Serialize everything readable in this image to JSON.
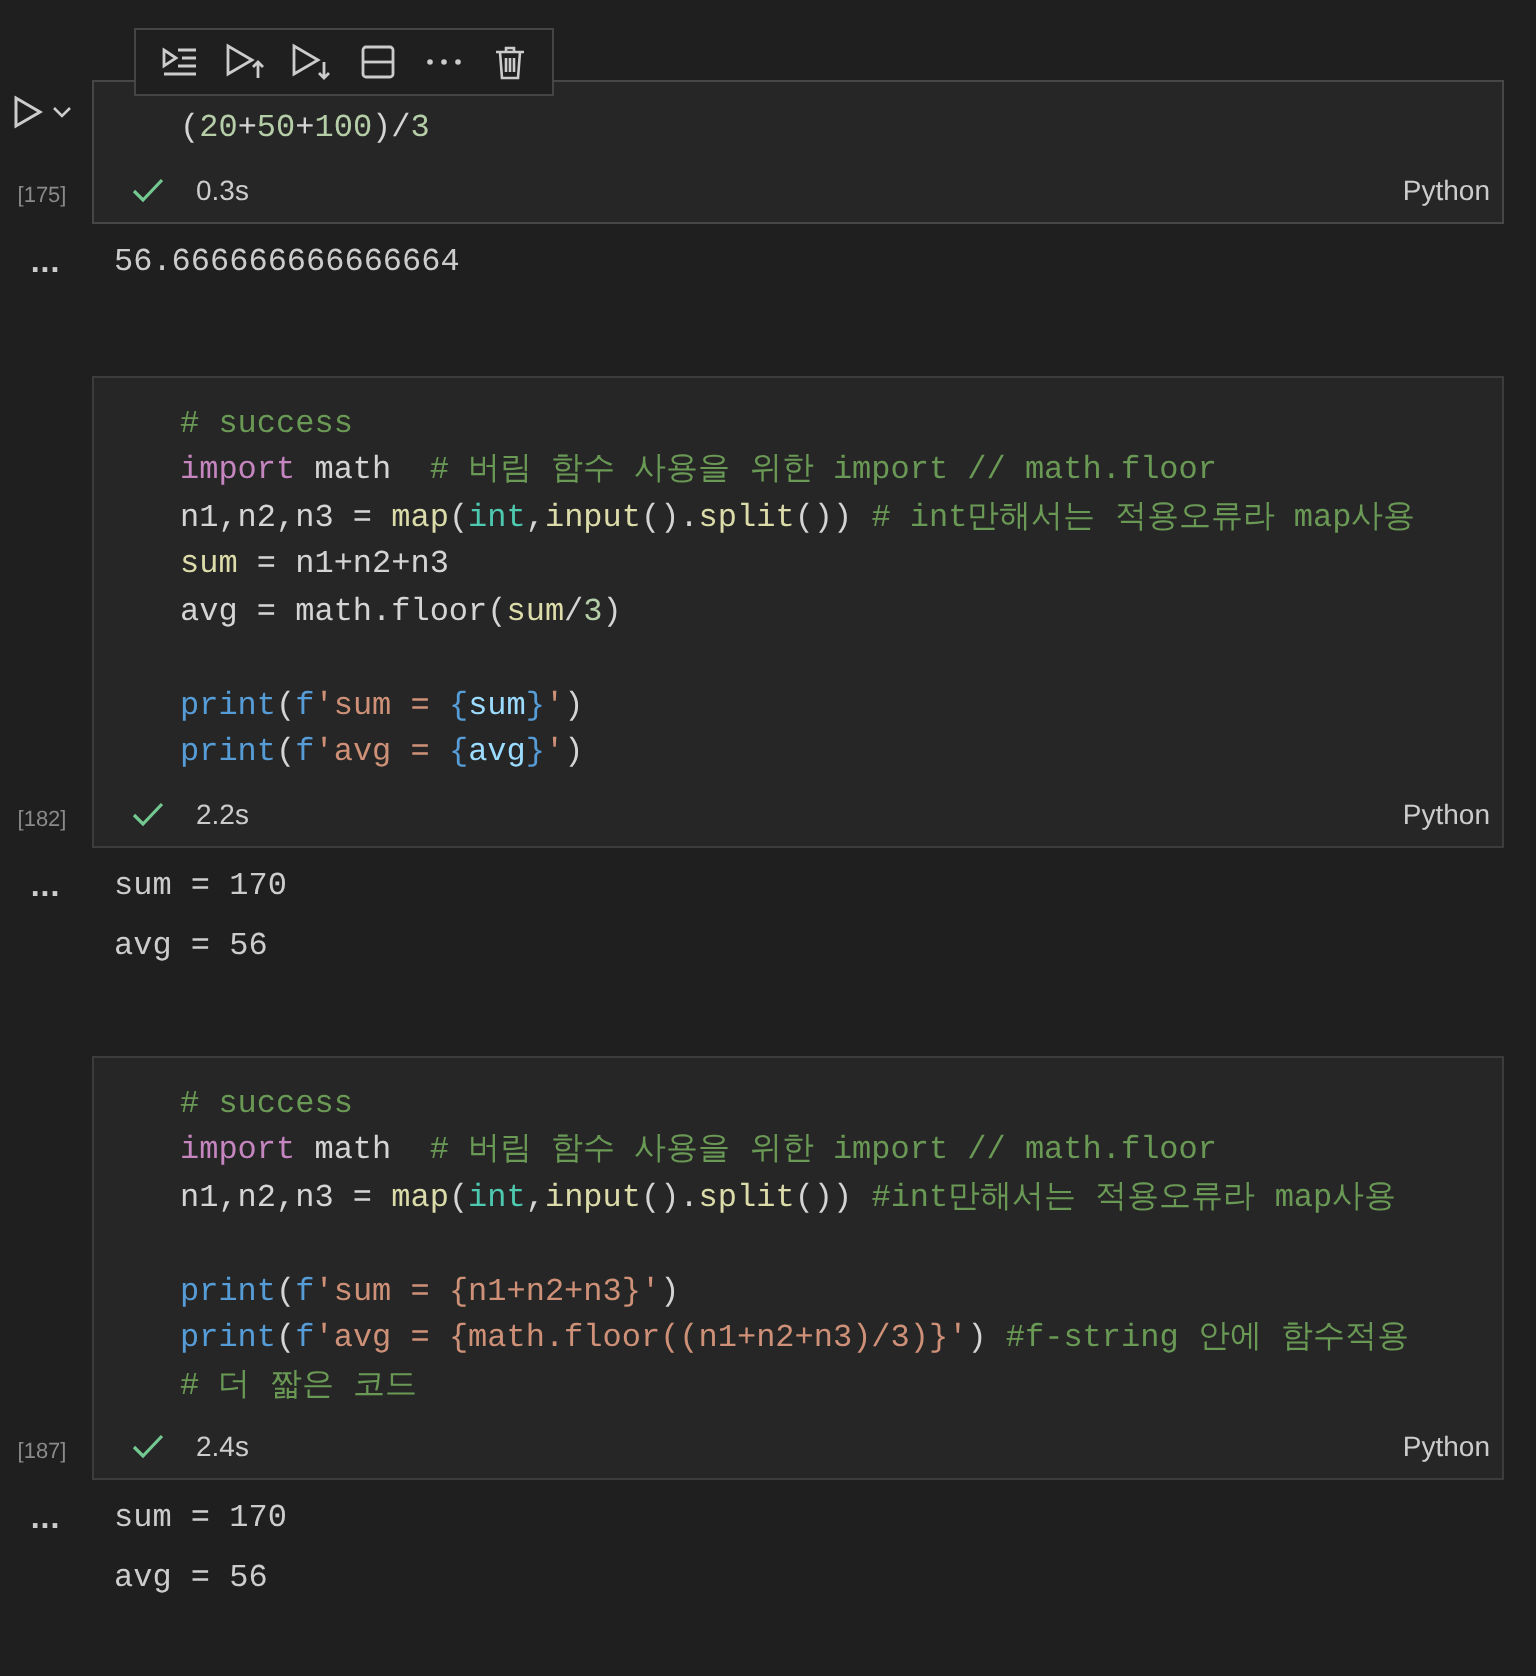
{
  "cells": [
    {
      "focused": true,
      "succeeded": true,
      "execution_count": "[175]",
      "duration": "0.3s",
      "language": "Python",
      "lines": [
        {
          "kind": "code",
          "tokens": [
            {
              "kind": "plain",
              "text": "("
            },
            {
              "kind": "number",
              "text": "20"
            },
            {
              "kind": "plain",
              "text": "+"
            },
            {
              "kind": "number",
              "text": "50"
            },
            {
              "kind": "plain",
              "text": "+"
            },
            {
              "kind": "number",
              "text": "100"
            },
            {
              "kind": "plain",
              "text": ")/"
            },
            {
              "kind": "number",
              "text": "3"
            }
          ]
        }
      ],
      "output_marker": "...",
      "outputs": [
        "56.666666666666664"
      ]
    },
    {
      "focused": false,
      "succeeded": true,
      "execution_count": "[182]",
      "duration": "2.2s",
      "language": "Python",
      "lines": [
        {
          "kind": "code",
          "tokens": [
            {
              "kind": "comment",
              "text": "# success"
            }
          ]
        },
        {
          "kind": "code",
          "tokens": [
            {
              "kind": "keyword",
              "text": "import"
            },
            {
              "kind": "plain",
              "text": " math  "
            },
            {
              "kind": "comment",
              "text": "# 버림 함수 사용을 위한 import // math.floor"
            }
          ]
        },
        {
          "kind": "code",
          "tokens": [
            {
              "kind": "plain",
              "text": "n1,n2,n3 = "
            },
            {
              "kind": "function",
              "text": "map"
            },
            {
              "kind": "plain",
              "text": "("
            },
            {
              "kind": "type",
              "text": "int"
            },
            {
              "kind": "plain",
              "text": ","
            },
            {
              "kind": "function",
              "text": "input"
            },
            {
              "kind": "plain",
              "text": "()."
            },
            {
              "kind": "function",
              "text": "split"
            },
            {
              "kind": "plain",
              "text": "()) "
            },
            {
              "kind": "comment",
              "text": "# int만해서는 적용오류라 map사용"
            }
          ]
        },
        {
          "kind": "code",
          "tokens": [
            {
              "kind": "function",
              "text": "sum"
            },
            {
              "kind": "plain",
              "text": " = n1+n2+n3"
            }
          ]
        },
        {
          "kind": "code",
          "tokens": [
            {
              "kind": "plain",
              "text": "avg = math.floor("
            },
            {
              "kind": "function",
              "text": "sum"
            },
            {
              "kind": "plain",
              "text": "/"
            },
            {
              "kind": "number",
              "text": "3"
            },
            {
              "kind": "plain",
              "text": ")"
            }
          ]
        },
        {
          "kind": "blank"
        },
        {
          "kind": "code",
          "tokens": [
            {
              "kind": "builtin",
              "text": "print"
            },
            {
              "kind": "plain",
              "text": "("
            },
            {
              "kind": "builtin",
              "text": "f"
            },
            {
              "kind": "string",
              "text": "'sum = "
            },
            {
              "kind": "builtin",
              "text": "{"
            },
            {
              "kind": "variable",
              "text": "sum"
            },
            {
              "kind": "builtin",
              "text": "}"
            },
            {
              "kind": "string",
              "text": "'"
            },
            {
              "kind": "plain",
              "text": ")"
            }
          ]
        },
        {
          "kind": "code",
          "tokens": [
            {
              "kind": "builtin",
              "text": "print"
            },
            {
              "kind": "plain",
              "text": "("
            },
            {
              "kind": "builtin",
              "text": "f"
            },
            {
              "kind": "string",
              "text": "'avg = "
            },
            {
              "kind": "builtin",
              "text": "{"
            },
            {
              "kind": "variable",
              "text": "avg"
            },
            {
              "kind": "builtin",
              "text": "}"
            },
            {
              "kind": "string",
              "text": "'"
            },
            {
              "kind": "plain",
              "text": ")"
            }
          ]
        }
      ],
      "output_marker": "...",
      "outputs": [
        "sum = 170",
        "avg = 56"
      ]
    },
    {
      "focused": false,
      "succeeded": true,
      "execution_count": "[187]",
      "duration": "2.4s",
      "language": "Python",
      "lines": [
        {
          "kind": "code",
          "tokens": [
            {
              "kind": "comment",
              "text": "# success"
            }
          ]
        },
        {
          "kind": "code",
          "tokens": [
            {
              "kind": "keyword",
              "text": "import"
            },
            {
              "kind": "plain",
              "text": " math  "
            },
            {
              "kind": "comment",
              "text": "# 버림 함수 사용을 위한 import // math.floor"
            }
          ]
        },
        {
          "kind": "code",
          "tokens": [
            {
              "kind": "plain",
              "text": "n1,n2,n3 = "
            },
            {
              "kind": "function",
              "text": "map"
            },
            {
              "kind": "plain",
              "text": "("
            },
            {
              "kind": "type",
              "text": "int"
            },
            {
              "kind": "plain",
              "text": ","
            },
            {
              "kind": "function",
              "text": "input"
            },
            {
              "kind": "plain",
              "text": "()."
            },
            {
              "kind": "function",
              "text": "split"
            },
            {
              "kind": "plain",
              "text": "()) "
            },
            {
              "kind": "comment",
              "text": "#int만해서는 적용오류라 map사용"
            }
          ]
        },
        {
          "kind": "blank"
        },
        {
          "kind": "code",
          "tokens": [
            {
              "kind": "builtin",
              "text": "print"
            },
            {
              "kind": "plain",
              "text": "("
            },
            {
              "kind": "builtin",
              "text": "f"
            },
            {
              "kind": "string",
              "text": "'sum = {n1+n2+n3}'"
            },
            {
              "kind": "plain",
              "text": ")"
            }
          ]
        },
        {
          "kind": "code",
          "tokens": [
            {
              "kind": "builtin",
              "text": "print"
            },
            {
              "kind": "plain",
              "text": "("
            },
            {
              "kind": "builtin",
              "text": "f"
            },
            {
              "kind": "string",
              "text": "'avg = {math.floor((n1+n2+n3)/3)}'"
            },
            {
              "kind": "plain",
              "text": ") "
            },
            {
              "kind": "comment",
              "text": "#f-string 안에 함수적용"
            }
          ]
        },
        {
          "kind": "code",
          "tokens": [
            {
              "kind": "comment",
              "text": "# 더 짧은 코드"
            }
          ]
        }
      ],
      "output_marker": "...",
      "outputs": [
        "sum = 170",
        "avg = 56"
      ]
    }
  ]
}
